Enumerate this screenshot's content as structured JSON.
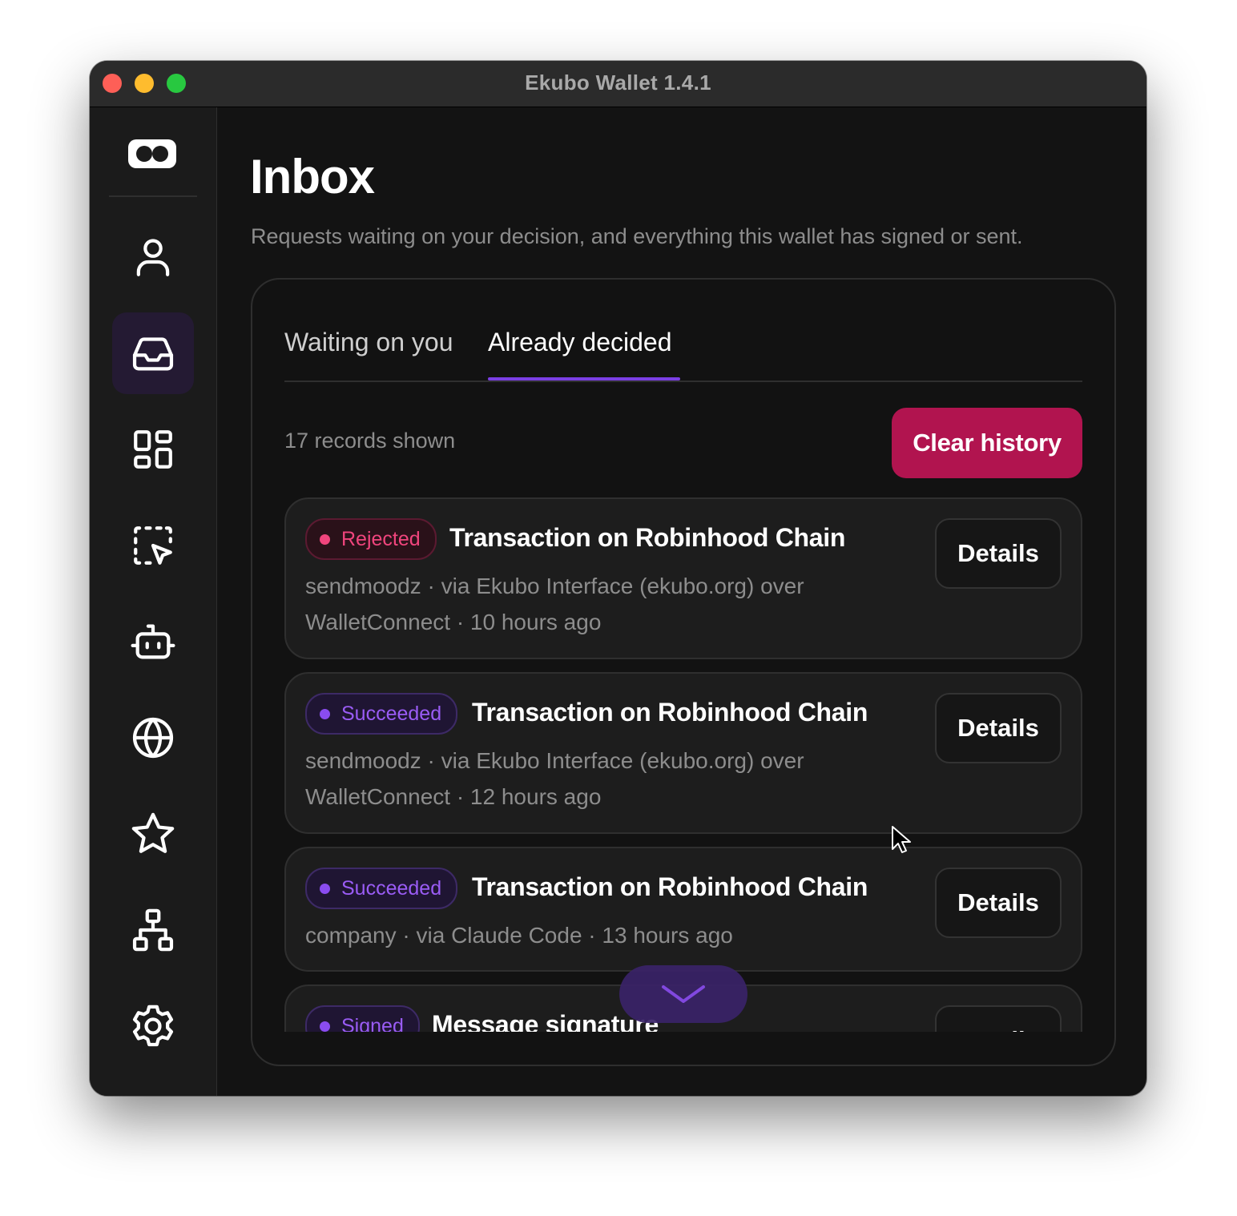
{
  "window": {
    "title": "Ekubo Wallet 1.4.1"
  },
  "sidebar": {
    "logo": "ekubo-logo-icon",
    "items": [
      {
        "icon": "user-icon",
        "active": false
      },
      {
        "icon": "inbox-icon",
        "active": true
      },
      {
        "icon": "apps-grid-icon",
        "active": false
      },
      {
        "icon": "selection-cursor-icon",
        "active": false
      },
      {
        "icon": "robot-icon",
        "active": false
      },
      {
        "icon": "globe-icon",
        "active": false
      },
      {
        "icon": "star-icon",
        "active": false
      },
      {
        "icon": "network-icon",
        "active": false
      },
      {
        "icon": "gear-icon",
        "active": false
      }
    ]
  },
  "main": {
    "title": "Inbox",
    "subtitle": "Requests waiting on your decision, and everything this wallet has signed or sent.",
    "tabs": [
      {
        "label": "Waiting on you",
        "active": false
      },
      {
        "label": "Already decided",
        "active": true
      }
    ],
    "records_count": "17 records shown",
    "clear_history_label": "Clear history",
    "records": [
      {
        "status": "Rejected",
        "title": "Transaction on Robinhood Chain",
        "meta": "sendmoodz · via Ekubo Interface (ekubo.org) over WalletConnect · 10 hours ago",
        "details_label": "Details"
      },
      {
        "status": "Succeeded",
        "title": "Transaction on Robinhood Chain",
        "meta": "sendmoodz · via Ekubo Interface (ekubo.org) over WalletConnect · 12 hours ago",
        "details_label": "Details"
      },
      {
        "status": "Succeeded",
        "title": "Transaction on Robinhood Chain",
        "meta": "company · via Claude Code · 13 hours ago",
        "details_label": "Details"
      },
      {
        "status": "Signed",
        "title": "Message signature",
        "meta": "",
        "details_label": "Details"
      }
    ]
  },
  "colors": {
    "accent": "#7b3fe4",
    "danger_button": "#b1144f",
    "rejected": "#f0457d",
    "succeeded": "#9a5cf5",
    "background": "#131313"
  }
}
